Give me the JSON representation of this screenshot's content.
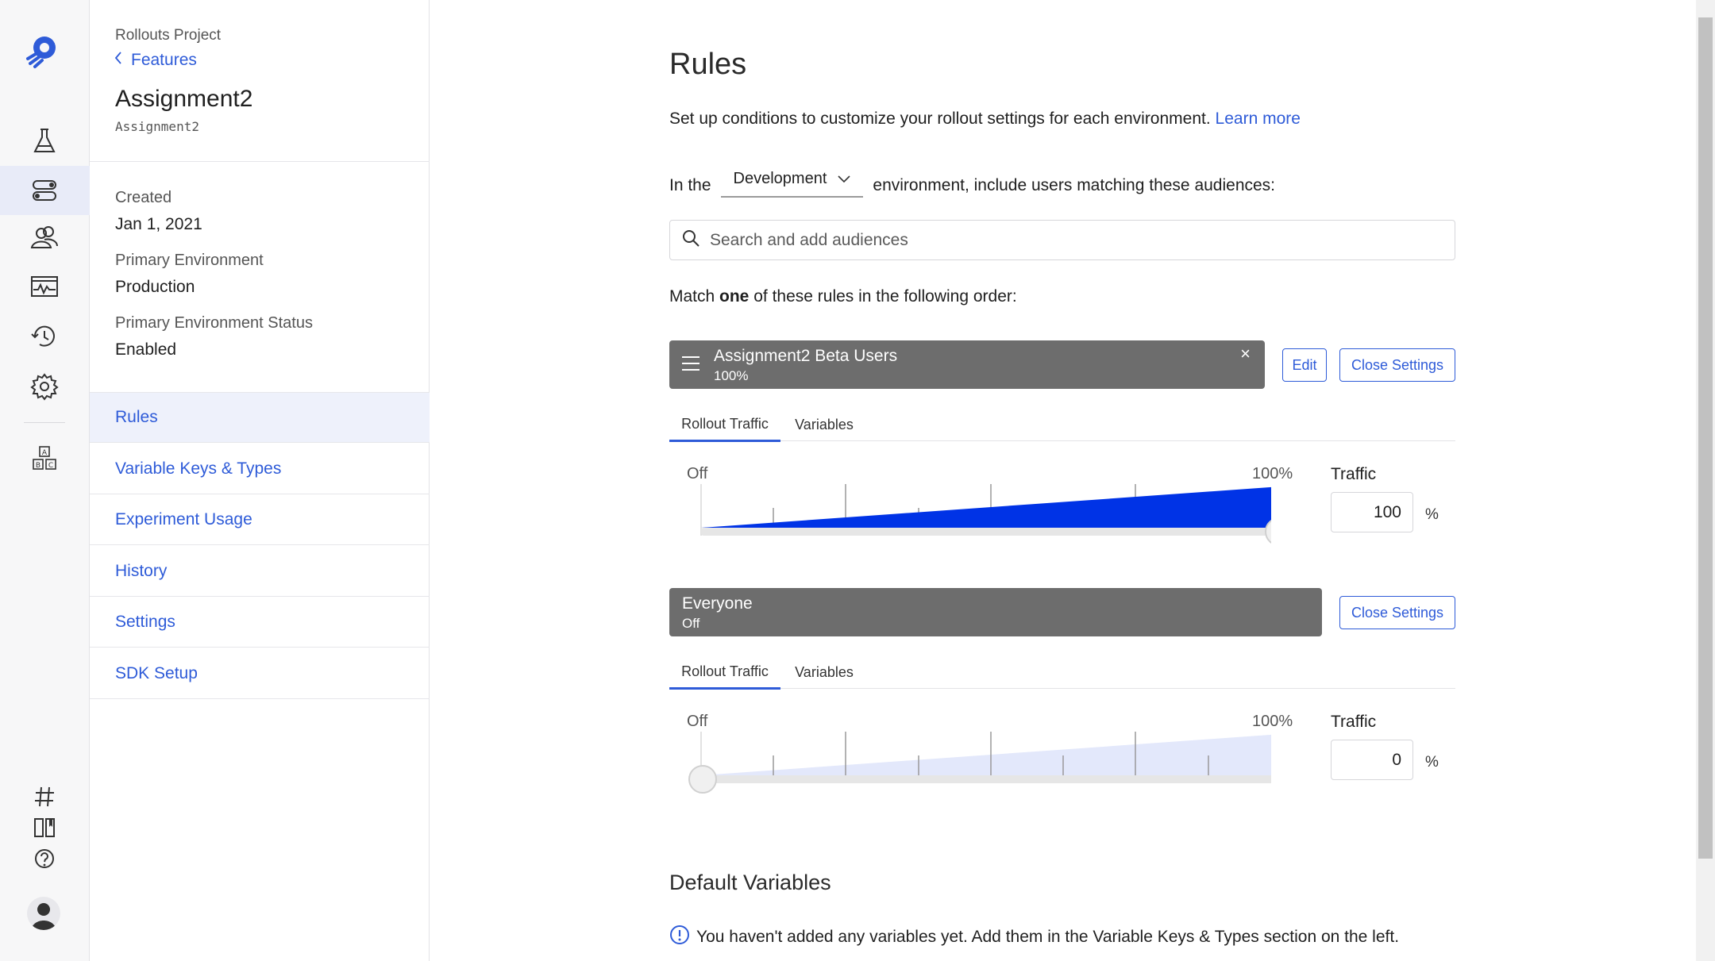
{
  "rail": {
    "icons": [
      "logo-icon",
      "flask-icon",
      "toggle-icon",
      "users-icon",
      "activity-icon",
      "history-icon",
      "gear-icon",
      "abc-icon",
      "hash-icon",
      "book-icon",
      "help-icon",
      "avatar-icon"
    ]
  },
  "sidebar": {
    "project": "Rollouts Project",
    "back_label": "Features",
    "feature_name": "Assignment2",
    "feature_key": "Assignment2",
    "meta": [
      {
        "label": "Created",
        "value": "Jan 1, 2021"
      },
      {
        "label": "Primary Environment",
        "value": "Production"
      },
      {
        "label": "Primary Environment Status",
        "value": "Enabled"
      }
    ],
    "nav": [
      "Rules",
      "Variable Keys & Types",
      "Experiment Usage",
      "History",
      "Settings",
      "SDK Setup"
    ],
    "active_nav": "Rules"
  },
  "main": {
    "title": "Rules",
    "intro": "Set up conditions to customize your rollout settings for each environment.",
    "learn_more": "Learn more",
    "env_prefix": "In the",
    "env_value": "Development",
    "env_suffix": "environment, include users matching these audiences:",
    "search_placeholder": "Search and add audiences",
    "match_prefix": "Match",
    "match_bold": "one",
    "match_suffix": "of these rules in the following order:",
    "rules": [
      {
        "name": "Assignment2 Beta Users",
        "status": "100%",
        "edit_label": "Edit",
        "close_label": "Close Settings",
        "remove_glyph": "×",
        "tabs": [
          "Rollout Traffic",
          "Variables"
        ],
        "off_label": "Off",
        "max_label": "100%",
        "traffic_label": "Traffic",
        "traffic_value": "100",
        "traffic_unit": "%",
        "traffic_fraction": 1.0
      },
      {
        "name": "Everyone",
        "status": "Off",
        "close_label": "Close Settings",
        "tabs": [
          "Rollout Traffic",
          "Variables"
        ],
        "off_label": "Off",
        "max_label": "100%",
        "traffic_label": "Traffic",
        "traffic_value": "0",
        "traffic_unit": "%",
        "traffic_fraction": 0.0
      }
    ],
    "default_variables_title": "Default Variables",
    "default_variables_notice": "You haven't added any variables yet. Add them in the Variable Keys & Types section on the left."
  },
  "colors": {
    "accent": "#2e5bd8",
    "rule_bar": "#6d6d6d",
    "slider_fill": "#0033e6",
    "slider_fill_off": "#e3e8fb"
  }
}
